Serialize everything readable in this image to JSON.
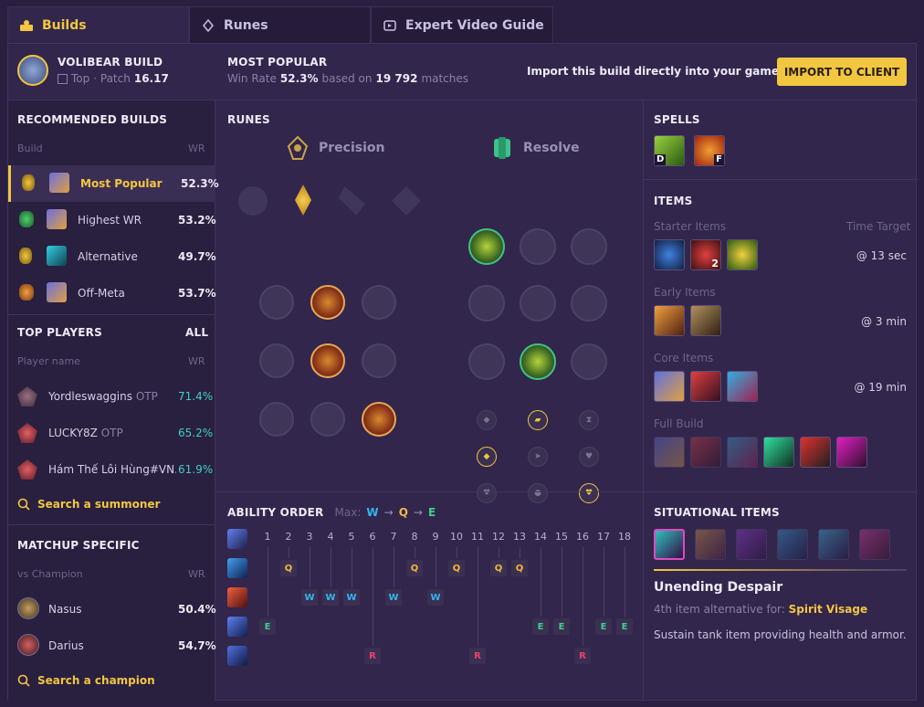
{
  "tabs": [
    {
      "label": "Builds",
      "icon": "builds-icon"
    },
    {
      "label": "Runes",
      "icon": "runes-icon"
    },
    {
      "label": "Expert Video Guide",
      "icon": "video-icon"
    }
  ],
  "header": {
    "champ_title": "VOLIBEAR BUILD",
    "role": "Top",
    "patch_prefix": "· Patch",
    "patch": "16.17",
    "popular_title": "MOST POPULAR",
    "winrate_prefix": "Win Rate",
    "winrate": "52.3%",
    "based_on": "based on",
    "matches": "19 792",
    "matches_suffix": "matches",
    "import_text": "Import this build directly into your game client:",
    "import_button": "IMPORT TO CLIENT"
  },
  "recommended": {
    "title": "RECOMMENDED BUILDS",
    "col_build": "Build",
    "col_wr": "WR",
    "items": [
      {
        "label": "Most Popular",
        "wr": "52.3%",
        "active": true
      },
      {
        "label": "Highest WR",
        "wr": "53.2%"
      },
      {
        "label": "Alternative",
        "wr": "49.7%"
      },
      {
        "label": "Off-Meta",
        "wr": "53.7%"
      }
    ]
  },
  "top_players": {
    "title": "TOP PLAYERS",
    "all": "ALL",
    "col_name": "Player name",
    "col_wr": "WR",
    "items": [
      {
        "name": "Yordleswaggins",
        "tag": "OTP",
        "wr": "71.4%"
      },
      {
        "name": "LUCKY8Z",
        "tag": "OTP",
        "wr": "65.2%"
      },
      {
        "name": "Hám Thế Lôi Hùng#VN...",
        "tag": "",
        "wr": "61.9%"
      }
    ],
    "search": "Search a summoner"
  },
  "matchup": {
    "title": "MATCHUP SPECIFIC",
    "col_name": "vs Champion",
    "col_wr": "WR",
    "items": [
      {
        "name": "Nasus",
        "wr": "50.4%"
      },
      {
        "name": "Darius",
        "wr": "54.7%"
      }
    ],
    "search": "Search a champion"
  },
  "runes": {
    "title": "RUNES",
    "primary": "Precision",
    "secondary": "Resolve"
  },
  "spells": {
    "title": "SPELLS",
    "keys": [
      "D",
      "F"
    ]
  },
  "items": {
    "title": "ITEMS",
    "starter": {
      "label": "Starter Items",
      "target_label": "Time Target",
      "time": "@ 13 sec",
      "count": "2"
    },
    "early": {
      "label": "Early Items",
      "time": "@ 3 min"
    },
    "core": {
      "label": "Core Items",
      "time": "@ 19 min"
    },
    "full": {
      "label": "Full Build"
    }
  },
  "ability": {
    "title": "ABILITY ORDER",
    "max_label": "Max:",
    "max_order": [
      "W",
      "Q",
      "E"
    ],
    "levels": [
      "1",
      "2",
      "3",
      "4",
      "5",
      "6",
      "7",
      "8",
      "9",
      "10",
      "11",
      "12",
      "13",
      "14",
      "15",
      "16",
      "17",
      "18"
    ],
    "sequence": [
      "E",
      "Q",
      "W",
      "W",
      "W",
      "R",
      "W",
      "Q",
      "W",
      "Q",
      "R",
      "Q",
      "Q",
      "E",
      "E",
      "R",
      "E",
      "E"
    ]
  },
  "situational": {
    "title": "SITUATIONAL ITEMS",
    "selected_name": "Unending Despair",
    "alt_prefix": "4th item alternative for:",
    "alt_for": "Spirit Visage",
    "description": "Sustain tank item providing health and armor."
  },
  "colors": {
    "accent": "#f2c640",
    "wr_teal": "#3fd0c0",
    "q": "#f2b840",
    "w": "#2fb7ee",
    "e": "#3fd08a",
    "r": "#ee3f6c"
  }
}
